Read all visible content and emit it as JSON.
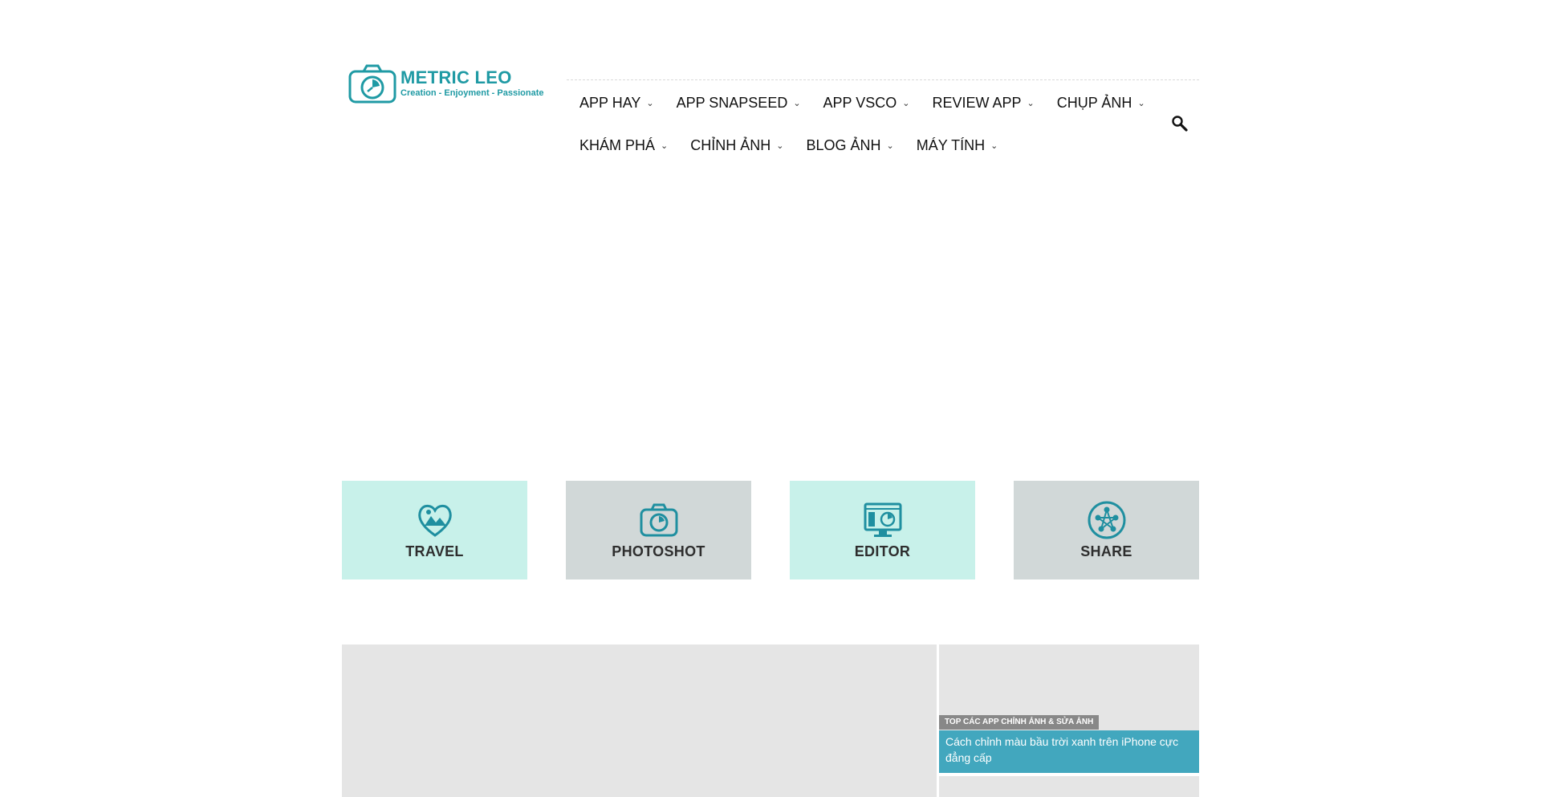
{
  "logo": {
    "title": "METRIC LEO",
    "tagline": "Creation - Enjoyment - Passionate",
    "icon": "camera-clock-icon"
  },
  "nav": {
    "row1": [
      {
        "label": "APP HAY"
      },
      {
        "label": "APP SNAPSEED"
      },
      {
        "label": "APP VSCO"
      },
      {
        "label": "REVIEW APP"
      },
      {
        "label": "CHỤP ẢNH"
      }
    ],
    "row2": [
      {
        "label": "KHÁM PHÁ"
      },
      {
        "label": "CHỈNH ẢNH"
      },
      {
        "label": "BLOG ẢNH"
      },
      {
        "label": "MÁY TÍNH"
      }
    ],
    "dropdown_icon": "chevron-down-icon",
    "search_icon": "search-icon"
  },
  "categories": [
    {
      "label": "TRAVEL",
      "icon": "heart-mountain-icon",
      "color": "#c8f1ea"
    },
    {
      "label": "PHOTOSHOT",
      "icon": "camera-icon",
      "color": "#d1d8d8"
    },
    {
      "label": "EDITOR",
      "icon": "monitor-icon",
      "color": "#c8f1ea"
    },
    {
      "label": "SHARE",
      "icon": "share-network-icon",
      "color": "#d1d8d8"
    }
  ],
  "featured": {
    "side_badge": "TOP CÁC APP CHỈNH ẢNH & SỬA ẢNH",
    "side_title": "Cách chỉnh màu bầu trời xanh trên iPhone cực đẳng cấp"
  },
  "colors": {
    "brand": "#1f9aa4",
    "teal_block": "#c8f1ea",
    "grey_block": "#d1d8d8",
    "title_bar": "#42a7be"
  }
}
